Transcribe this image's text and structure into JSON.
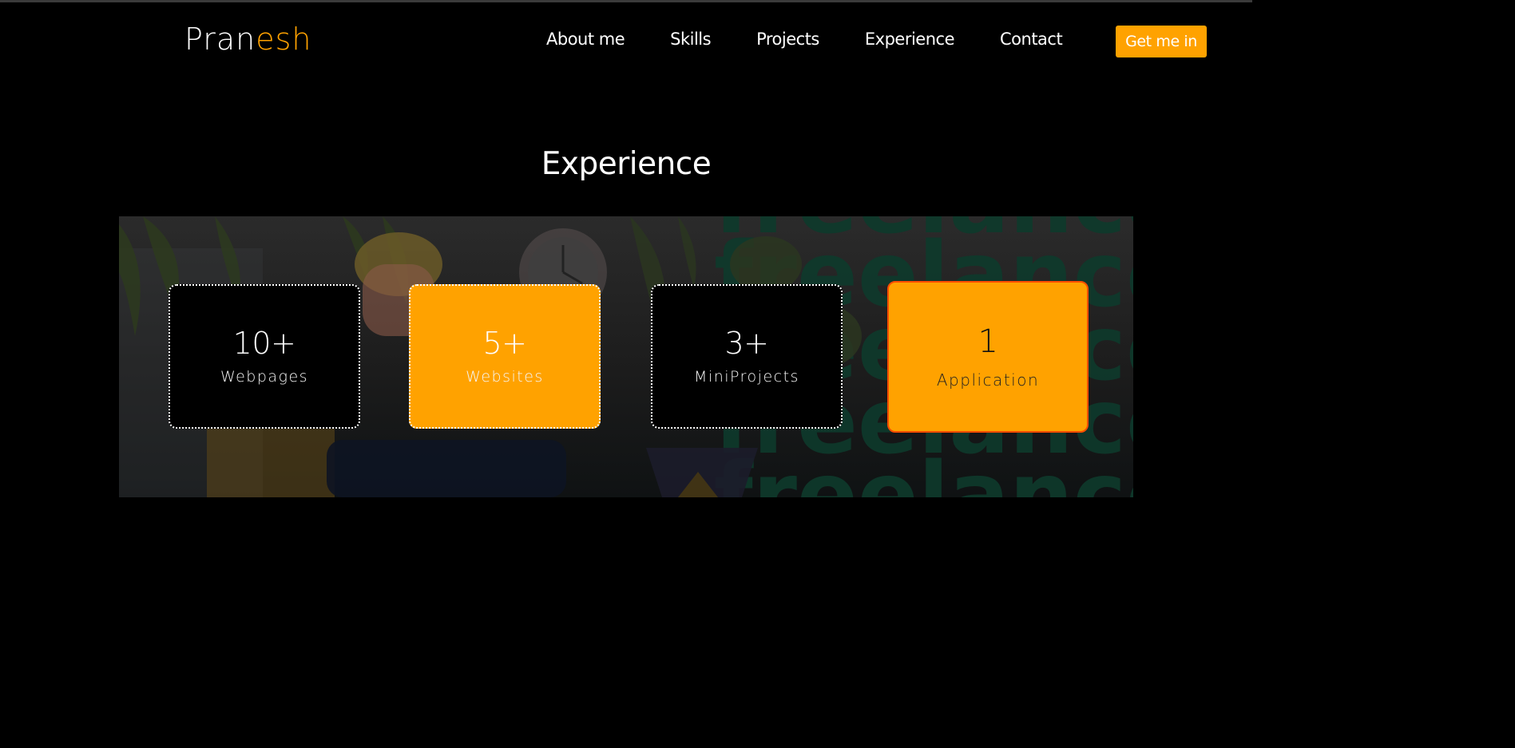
{
  "header": {
    "logo_part1": "Pran",
    "logo_part2": "esh",
    "nav": [
      "About me",
      "Skills",
      "Projects",
      "Experience",
      "Contact"
    ],
    "cta_label": "Get me in"
  },
  "section": {
    "title": "Experience",
    "banner_text": "freelance",
    "cards": [
      {
        "value": "10+",
        "label": "Webpages"
      },
      {
        "value": "5+",
        "label": "Websites"
      },
      {
        "value": "3+",
        "label": "MiniProjects"
      },
      {
        "value": "1",
        "label": "Application"
      }
    ]
  },
  "colors": {
    "accent": "#ffa200",
    "background": "#000000",
    "highlight_border": "#ff4d00"
  }
}
